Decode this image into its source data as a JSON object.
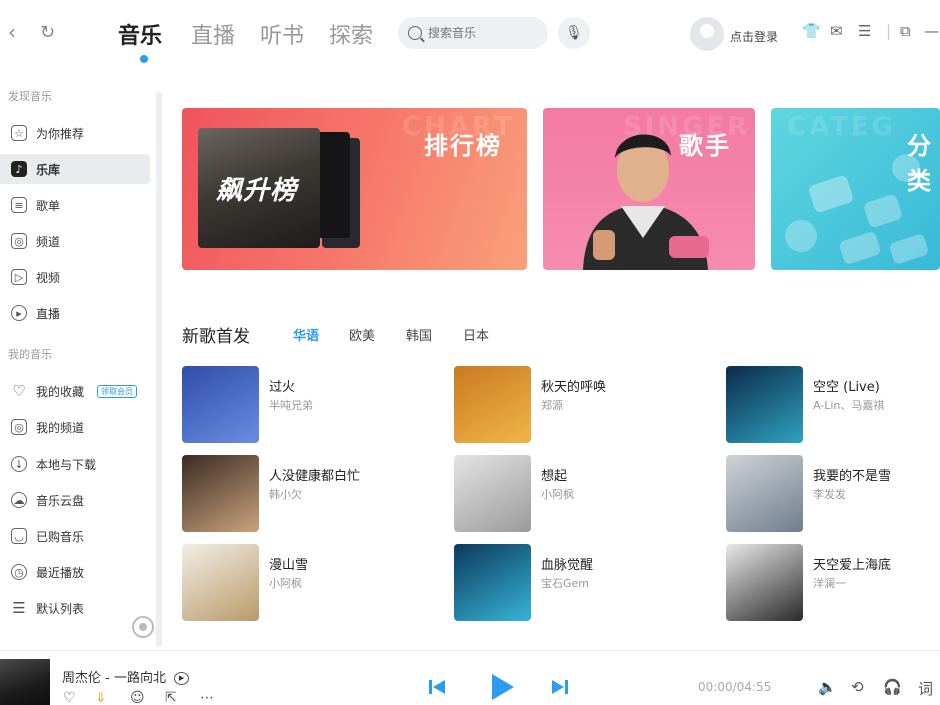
{
  "nav": {
    "back": "‹",
    "refresh": "↻"
  },
  "main_tabs": [
    {
      "label": "音乐",
      "active": true
    },
    {
      "label": "直播",
      "active": false
    },
    {
      "label": "听书",
      "active": false
    },
    {
      "label": "探索",
      "active": false
    }
  ],
  "search": {
    "placeholder": "搜索音乐"
  },
  "user": {
    "login_label": "点击登录"
  },
  "sidebar": {
    "sections": [
      {
        "header": "发现音乐",
        "items": [
          {
            "label": "为你推荐",
            "icon": "recommend-icon"
          },
          {
            "label": "乐库",
            "icon": "music-library-icon",
            "active": true
          },
          {
            "label": "歌单",
            "icon": "playlist-icon"
          },
          {
            "label": "频道",
            "icon": "radio-icon"
          },
          {
            "label": "视频",
            "icon": "video-icon"
          },
          {
            "label": "直播",
            "icon": "live-icon"
          }
        ]
      },
      {
        "header": "我的音乐",
        "items": [
          {
            "label": "我的收藏",
            "icon": "heart-icon",
            "badge": "领取会员"
          },
          {
            "label": "我的频道",
            "icon": "radio-icon"
          },
          {
            "label": "本地与下载",
            "icon": "download-icon"
          },
          {
            "label": "音乐云盘",
            "icon": "cloud-icon"
          },
          {
            "label": "已购音乐",
            "icon": "purchased-icon"
          },
          {
            "label": "最近播放",
            "icon": "clock-icon"
          },
          {
            "label": "默认列表",
            "icon": "list-icon"
          }
        ]
      }
    ]
  },
  "banners": [
    {
      "title": "排行榜",
      "watermark": "CHART",
      "album_text": "飙升榜"
    },
    {
      "title": "歌手",
      "watermark": "SINGER"
    },
    {
      "title": "分类",
      "watermark": "CATEG"
    }
  ],
  "new_songs": {
    "title": "新歌首发",
    "tabs": [
      {
        "label": "华语",
        "active": true
      },
      {
        "label": "欧美",
        "active": false
      },
      {
        "label": "韩国",
        "active": false
      },
      {
        "label": "日本",
        "active": false
      }
    ],
    "songs": [
      {
        "title": "过火",
        "artist": "半吨兄弟",
        "colors": [
          "#2f4ea8",
          "#6a8de0"
        ]
      },
      {
        "title": "秋天的呼唤",
        "artist": "郑源",
        "colors": [
          "#c87a1f",
          "#f2b54a"
        ]
      },
      {
        "title": "空空 (Live)",
        "artist": "A-Lin、马嘉祺",
        "colors": [
          "#0d2a4a",
          "#2fa2c0"
        ]
      },
      {
        "title": "人没健康都白忙",
        "artist": "韩小欠",
        "colors": [
          "#3b2b22",
          "#c9a37d"
        ]
      },
      {
        "title": "想起",
        "artist": "小阿枫",
        "colors": [
          "#e4e4e4",
          "#9a9a9a"
        ]
      },
      {
        "title": "我要的不是雪",
        "artist": "李发发",
        "colors": [
          "#cfd3d8",
          "#6f7d8c"
        ]
      },
      {
        "title": "漫山雪",
        "artist": "小阿枫",
        "colors": [
          "#f2eee6",
          "#b89a6a"
        ]
      },
      {
        "title": "血脉觉醒",
        "artist": "宝石Gem",
        "colors": [
          "#0c3a5c",
          "#37b4d8"
        ]
      },
      {
        "title": "天空爱上海底",
        "artist": "洋澜一",
        "colors": [
          "#e8e8e8",
          "#2a2a2a"
        ]
      }
    ]
  },
  "player": {
    "now_playing": "周杰伦 - 一路向北",
    "time": "00:00/04:55",
    "lyrics_label": "词"
  },
  "colors": {
    "accent": "#2b9cf0"
  }
}
